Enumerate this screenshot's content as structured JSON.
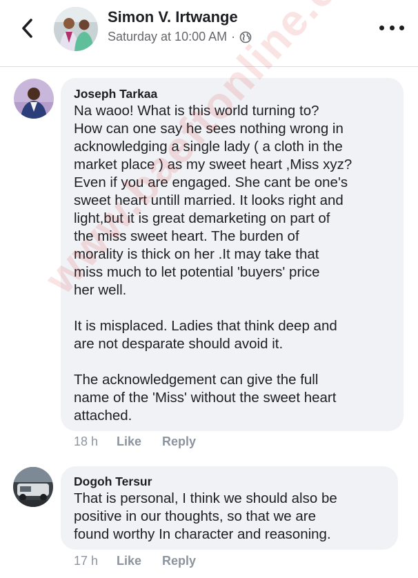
{
  "header": {
    "back_icon": "chevron-left-icon",
    "poster_name": "Simon V. Irtwange",
    "post_time": "Saturday at 10:00 AM",
    "separator": "·",
    "privacy_icon": "globe-icon",
    "more_icon": "more-options-icon"
  },
  "comments": [
    {
      "author": "Joseph Tarkaa",
      "text": "Na waoo! What is this world turning to?\nHow can one say he sees nothing wrong in\nacknowledging a single lady ( a cloth in the\nmarket place ) as my sweet heart ,Miss xyz?\nEven if you are engaged. She cant be one's\nsweet heart untill married. It looks right and\nlight,but it is great demarketing on part of\nthe miss sweet heart. The burden of\nmorality is thick on her .It may take that\nmiss  much to let potential 'buyers' price\nher well.\n\nIt is misplaced. Ladies that think deep and\nare not desparate should avoid  it.\n\nThe acknowledgement can give the full\nname of the 'Miss' without the sweet heart\nattached.",
      "time": "18 h",
      "like_label": "Like",
      "reply_label": "Reply"
    },
    {
      "author": "Dogoh Tersur",
      "text": "That is personal,  I think  we should also be\npositive in our thoughts, so that we are\nfound worthy  In character and reasoning.",
      "time": "17 h",
      "like_label": "Like",
      "reply_label": "Reply"
    }
  ],
  "watermark": "www.baeftonline.com"
}
